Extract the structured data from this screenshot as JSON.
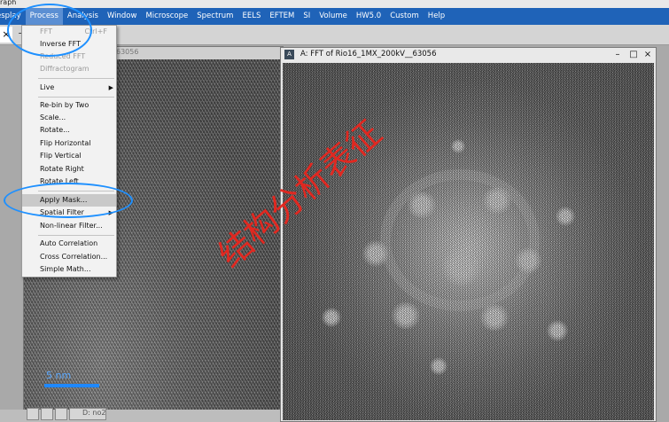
{
  "app": {
    "title_fragment": "raph"
  },
  "menubar": {
    "items": [
      "esplay",
      "Process",
      "Analysis",
      "Window",
      "Microscope",
      "Spectrum",
      "EELS",
      "EFTEM",
      "SI",
      "Volume",
      "HW5.0",
      "Custom",
      "Help"
    ],
    "open": "Process"
  },
  "tabs": {
    "close_symbol": "×",
    "new_symbol": "+"
  },
  "left_window": {
    "title_fragment": "63056",
    "scale_label": "5 nm",
    "minimized_label": "D: no2"
  },
  "fft_window": {
    "title": "A: FFT of Rio16_1MX_200kV__63056",
    "buttons": [
      "–",
      "□",
      "×"
    ]
  },
  "dropdown": {
    "items": [
      {
        "label": "FFT",
        "shortcut": "Ctrl+F",
        "disabled": true
      },
      {
        "label": "Inverse FFT",
        "shortcut": "",
        "disabled": false
      },
      {
        "label": "Reduced FFT",
        "shortcut": "",
        "disabled": true
      },
      {
        "label": "Diffractogram",
        "shortcut": "",
        "disabled": true
      },
      {
        "label": "Live",
        "shortcut": "",
        "disabled": false,
        "submenu": true
      },
      {
        "label": "Re-bin by Two",
        "shortcut": "",
        "disabled": false
      },
      {
        "label": "Scale...",
        "shortcut": "",
        "disabled": false
      },
      {
        "label": "Rotate...",
        "shortcut": "",
        "disabled": false
      },
      {
        "label": "Flip Horizontal",
        "shortcut": "",
        "disabled": false
      },
      {
        "label": "Flip Vertical",
        "shortcut": "",
        "disabled": false
      },
      {
        "label": "Rotate Right",
        "shortcut": "",
        "disabled": false
      },
      {
        "label": "Rotate Left",
        "shortcut": "",
        "disabled": false
      },
      {
        "label": "Apply Mask...",
        "shortcut": "",
        "disabled": false,
        "highlighted": true
      },
      {
        "label": "Spatial Filter",
        "shortcut": "",
        "disabled": false,
        "submenu": true
      },
      {
        "label": "Non-linear Filter...",
        "shortcut": "",
        "disabled": false
      },
      {
        "label": "Auto Correlation",
        "shortcut": "",
        "disabled": false
      },
      {
        "label": "Cross Correlation...",
        "shortcut": "",
        "disabled": false
      },
      {
        "label": "Simple Math...",
        "shortcut": "",
        "disabled": false
      }
    ]
  },
  "watermark": "结构分析表征",
  "colors": {
    "menubar": "#1f63b8",
    "annotation": "#1e90ff",
    "watermark": "#e8261e"
  }
}
